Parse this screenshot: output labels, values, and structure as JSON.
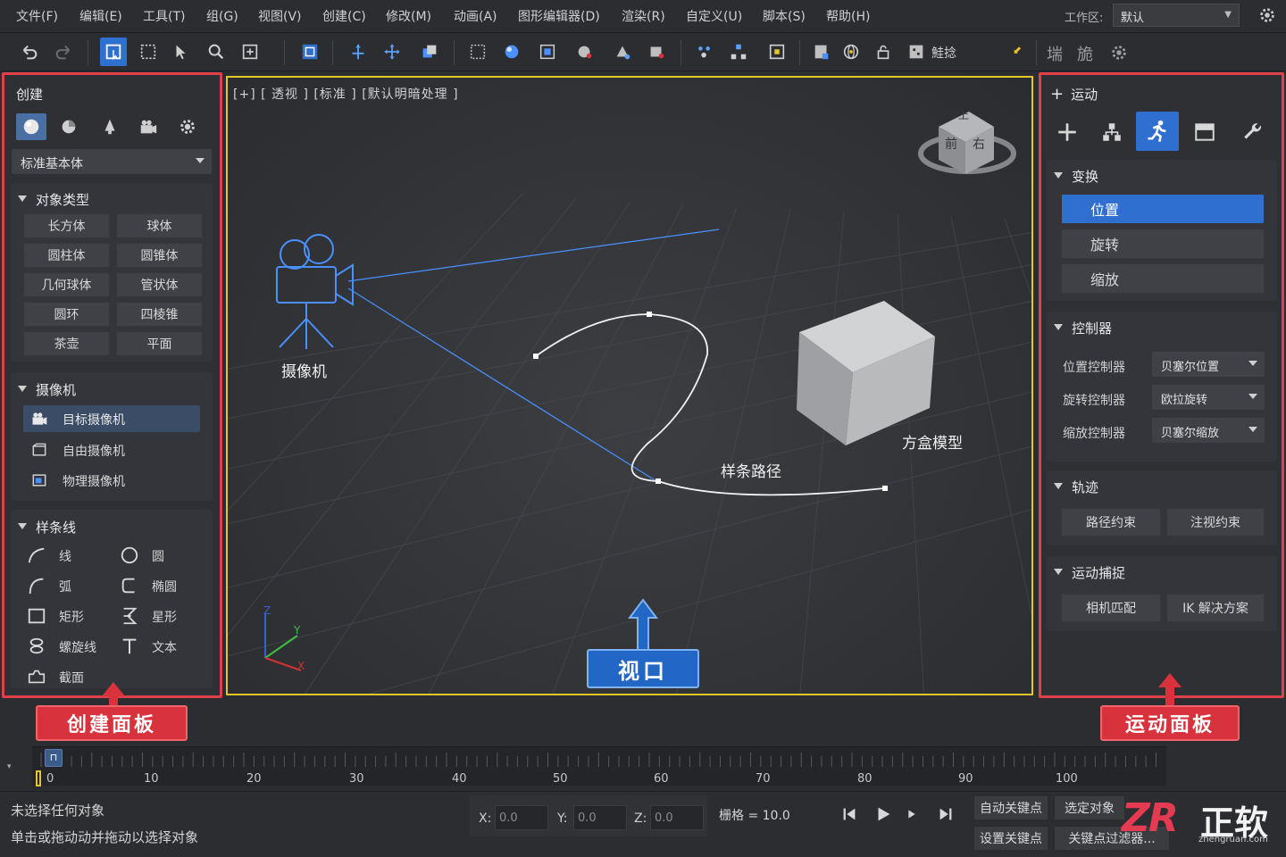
{
  "menu": [
    "文件(F)",
    "编辑(E)",
    "工具(T)",
    "组(G)",
    "视图(V)",
    "创建(C)",
    "修改(M)",
    "动画(A)",
    "图形编辑器(D)",
    "渲染(R)",
    "自定义(U)",
    "脚本(S)",
    "帮助(H)"
  ],
  "workspace": {
    "label": "工作区:",
    "value": "默认"
  },
  "toolbar": {
    "selection_set_label": "鮭捻"
  },
  "create_panel": {
    "title": "创建",
    "dropdown": "标准基本体",
    "object_type": {
      "title": "对象类型",
      "buttons": [
        "长方体",
        "球体",
        "圆柱体",
        "圆锥体",
        "几何球体",
        "管状体",
        "圆环",
        "四棱锥",
        "茶壶",
        "平面"
      ]
    },
    "camera": {
      "title": "摄像机",
      "items": [
        "目标摄像机",
        "自由摄像机",
        "物理摄像机"
      ]
    },
    "spline": {
      "title": "样条线",
      "items": [
        "线",
        "圆",
        "弧",
        "椭圆",
        "矩形",
        "星形",
        "螺旋线",
        "文本",
        "截面"
      ]
    },
    "callout": "创建面板"
  },
  "viewport": {
    "label": "[+] [ 透视 ] [标准 ] [默认明暗处理 ]",
    "camera_label": "摄像机",
    "spline_label": "样条路径",
    "box_label": "方盒模型",
    "cube_faces": {
      "top": "上",
      "front": "前",
      "right": "右"
    },
    "axis": {
      "x": "X",
      "y": "Y",
      "z": "Z"
    },
    "callout": "视口"
  },
  "motion_panel": {
    "title": "运动",
    "transform": {
      "title": "变换",
      "items": [
        "位置",
        "旋转",
        "缩放"
      ],
      "selected": "位置"
    },
    "controllers": {
      "title": "控制器",
      "rows": [
        {
          "label": "位置控制器",
          "value": "贝塞尔位置"
        },
        {
          "label": "旋转控制器",
          "value": "欧拉旋转"
        },
        {
          "label": "缩放控制器",
          "value": "贝塞尔缩放"
        }
      ]
    },
    "trajectory": {
      "title": "轨迹",
      "buttons": [
        "路径约束",
        "注视约束"
      ]
    },
    "motion_capture": {
      "title": "运动捕捉",
      "buttons": [
        "相机匹配",
        "IK 解决方案"
      ]
    },
    "callout": "运动面板"
  },
  "timeline": {
    "ticks": [
      "0",
      "10",
      "20",
      "30",
      "40",
      "50",
      "60",
      "70",
      "80",
      "90",
      "100"
    ],
    "current_frame": 0
  },
  "status": {
    "line1": "未选择任何对象",
    "line2": "单击或拖动动并拖动以选择对象",
    "x_label": "X:",
    "x_value": "0.0",
    "y_label": "Y:",
    "y_value": "0.0",
    "z_label": "Z:",
    "z_value": "0.0",
    "grid": "栅格 = 10.0",
    "auto_key": "自动关键点",
    "set_key": "设置关键点",
    "selected_object": "选定对象",
    "key_filter": "关键点过滤器..."
  },
  "watermark": {
    "logo": "ZR",
    "text": "正软",
    "url": "zhengruan.com"
  },
  "colors": {
    "accent": "#2f6fd0",
    "callout_red": "#d8333c",
    "viewport_border": "#e6c52a",
    "camera_blue": "#4a90ff"
  }
}
